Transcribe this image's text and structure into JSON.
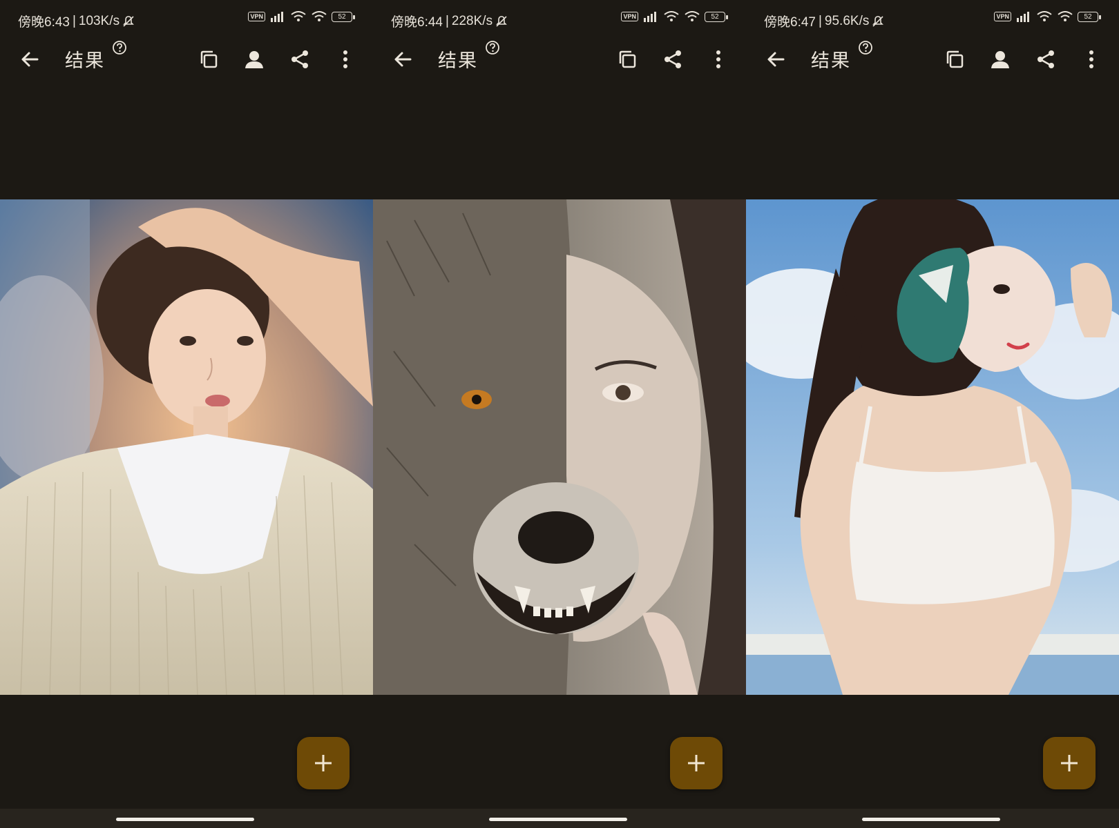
{
  "panels": [
    {
      "status": {
        "time": "傍晚6:43",
        "speed": "103K/s",
        "vpn": "VPN",
        "battery": "52"
      },
      "app_bar": {
        "title": "结果"
      },
      "image": {
        "kind": "portrait-girl-sweater"
      }
    },
    {
      "status": {
        "time": "傍晚6:44",
        "speed": "228K/s",
        "vpn": "VPN",
        "battery": "52"
      },
      "app_bar": {
        "title": "结果"
      },
      "image": {
        "kind": "wolf-face-half-human"
      }
    },
    {
      "status": {
        "time": "傍晚6:47",
        "speed": "95.6K/s",
        "vpn": "VPN",
        "battery": "52"
      },
      "app_bar": {
        "title": "结果"
      },
      "image": {
        "kind": "girl-with-heart-mask"
      }
    }
  ],
  "icons": {
    "back": "arrow-left-icon",
    "help": "question-circle-icon",
    "copy": "copy-icon",
    "face": "person-icon",
    "share": "share-icon",
    "more": "more-vert-icon",
    "add": "plus-icon"
  },
  "colors": {
    "background": "#1c1914",
    "fab": "#6e4a06",
    "text": "#ece6dc"
  },
  "separator": "|"
}
